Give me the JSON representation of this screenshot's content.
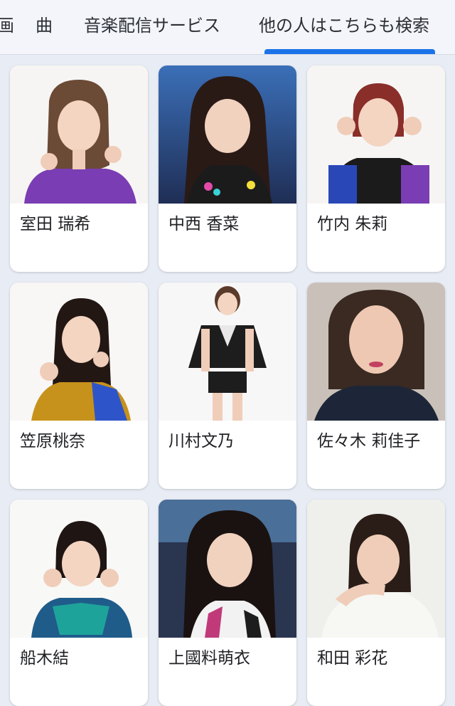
{
  "tabs": [
    {
      "label": "画"
    },
    {
      "label": "曲"
    },
    {
      "label": "音楽配信サービス"
    },
    {
      "label": "他の人はこちらも検索",
      "active": true
    }
  ],
  "colors": {
    "accent": "#1a73e8",
    "background": "#e8ecf4",
    "card": "#ffffff"
  },
  "people": [
    {
      "name": "室田 瑞希"
    },
    {
      "name": "中西 香菜"
    },
    {
      "name": "竹内 朱莉"
    },
    {
      "name": "笠原桃奈"
    },
    {
      "name": "川村文乃"
    },
    {
      "name": "佐々木 莉佳子"
    },
    {
      "name": "船木結"
    },
    {
      "name": "上國料萌衣"
    },
    {
      "name": "和田 彩花"
    }
  ]
}
